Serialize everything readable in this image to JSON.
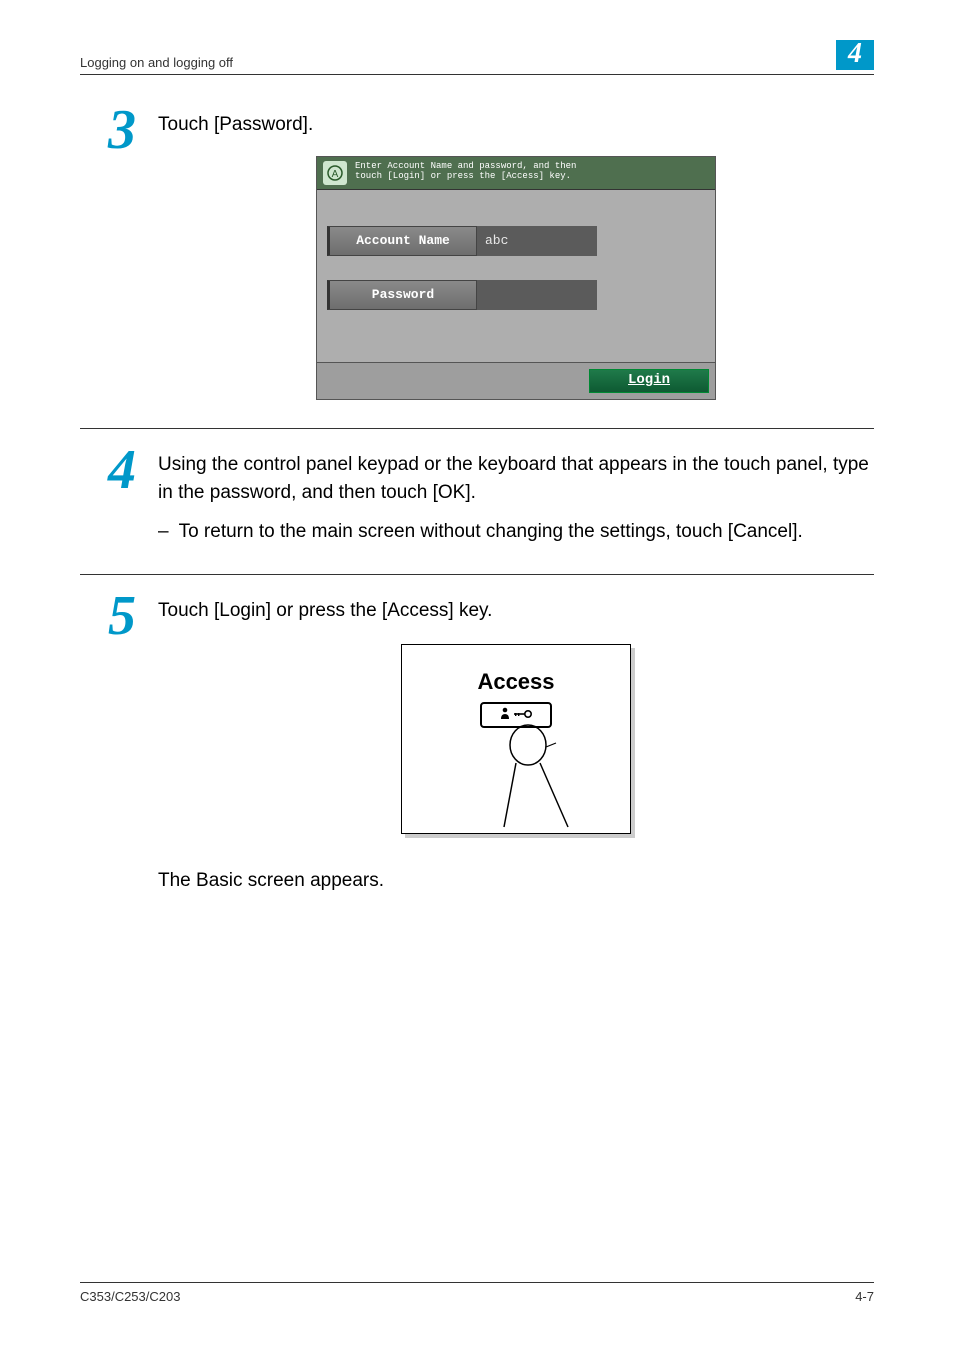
{
  "header": {
    "section_title": "Logging on and logging off",
    "chapter_number": "4"
  },
  "steps": [
    {
      "number": "3",
      "text": "Touch [Password].",
      "touchpanel": {
        "instruction_line1": "Enter Account Name and password, and then",
        "instruction_line2": "touch [Login] or press the [Access] key.",
        "account_label": "Account Name",
        "account_value": "abc",
        "password_label": "Password",
        "password_value": "",
        "login_label": "Login"
      }
    },
    {
      "number": "4",
      "text": "Using the control panel keypad or the keyboard that appears in the touch panel, type in the password, and then touch [OK].",
      "bullet": "To return to the main screen without changing the settings, touch [Cancel]."
    },
    {
      "number": "5",
      "text": "Touch [Login] or press the [Access] key.",
      "access_label": "Access",
      "result": "The Basic screen appears."
    }
  ],
  "footer": {
    "model": "C353/C253/C203",
    "page": "4-7"
  }
}
